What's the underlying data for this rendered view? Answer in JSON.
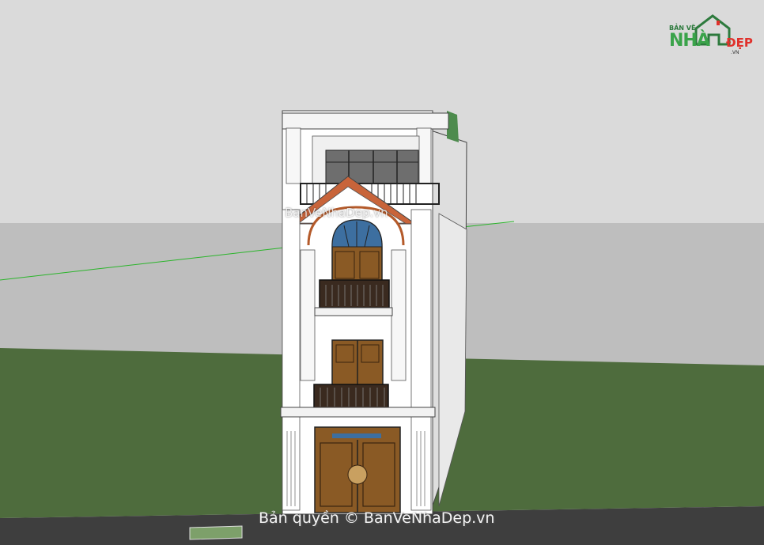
{
  "watermark": {
    "logo_small": "BẢN VẼ",
    "logo_big": "NHÀ",
    "logo_accent": "ĐẸP",
    "logo_domain": ".VN",
    "center_text": "BanVeNhaDep.vn",
    "copyright_text": "Bản quyền © BanVeNhaDep.vn"
  },
  "colors": {
    "sky": "#d9d9d9",
    "ground_far": "#bdbdbd",
    "grass": "#4d6b3c",
    "road": "#3d3d3d",
    "wall": "#ffffff",
    "roof_tile": "#c8643a",
    "door_wood": "#8a5a25",
    "glass": "#3d6fa0",
    "axis_green": "#2bb52b"
  },
  "icons": [
    "house-logo-icon"
  ]
}
